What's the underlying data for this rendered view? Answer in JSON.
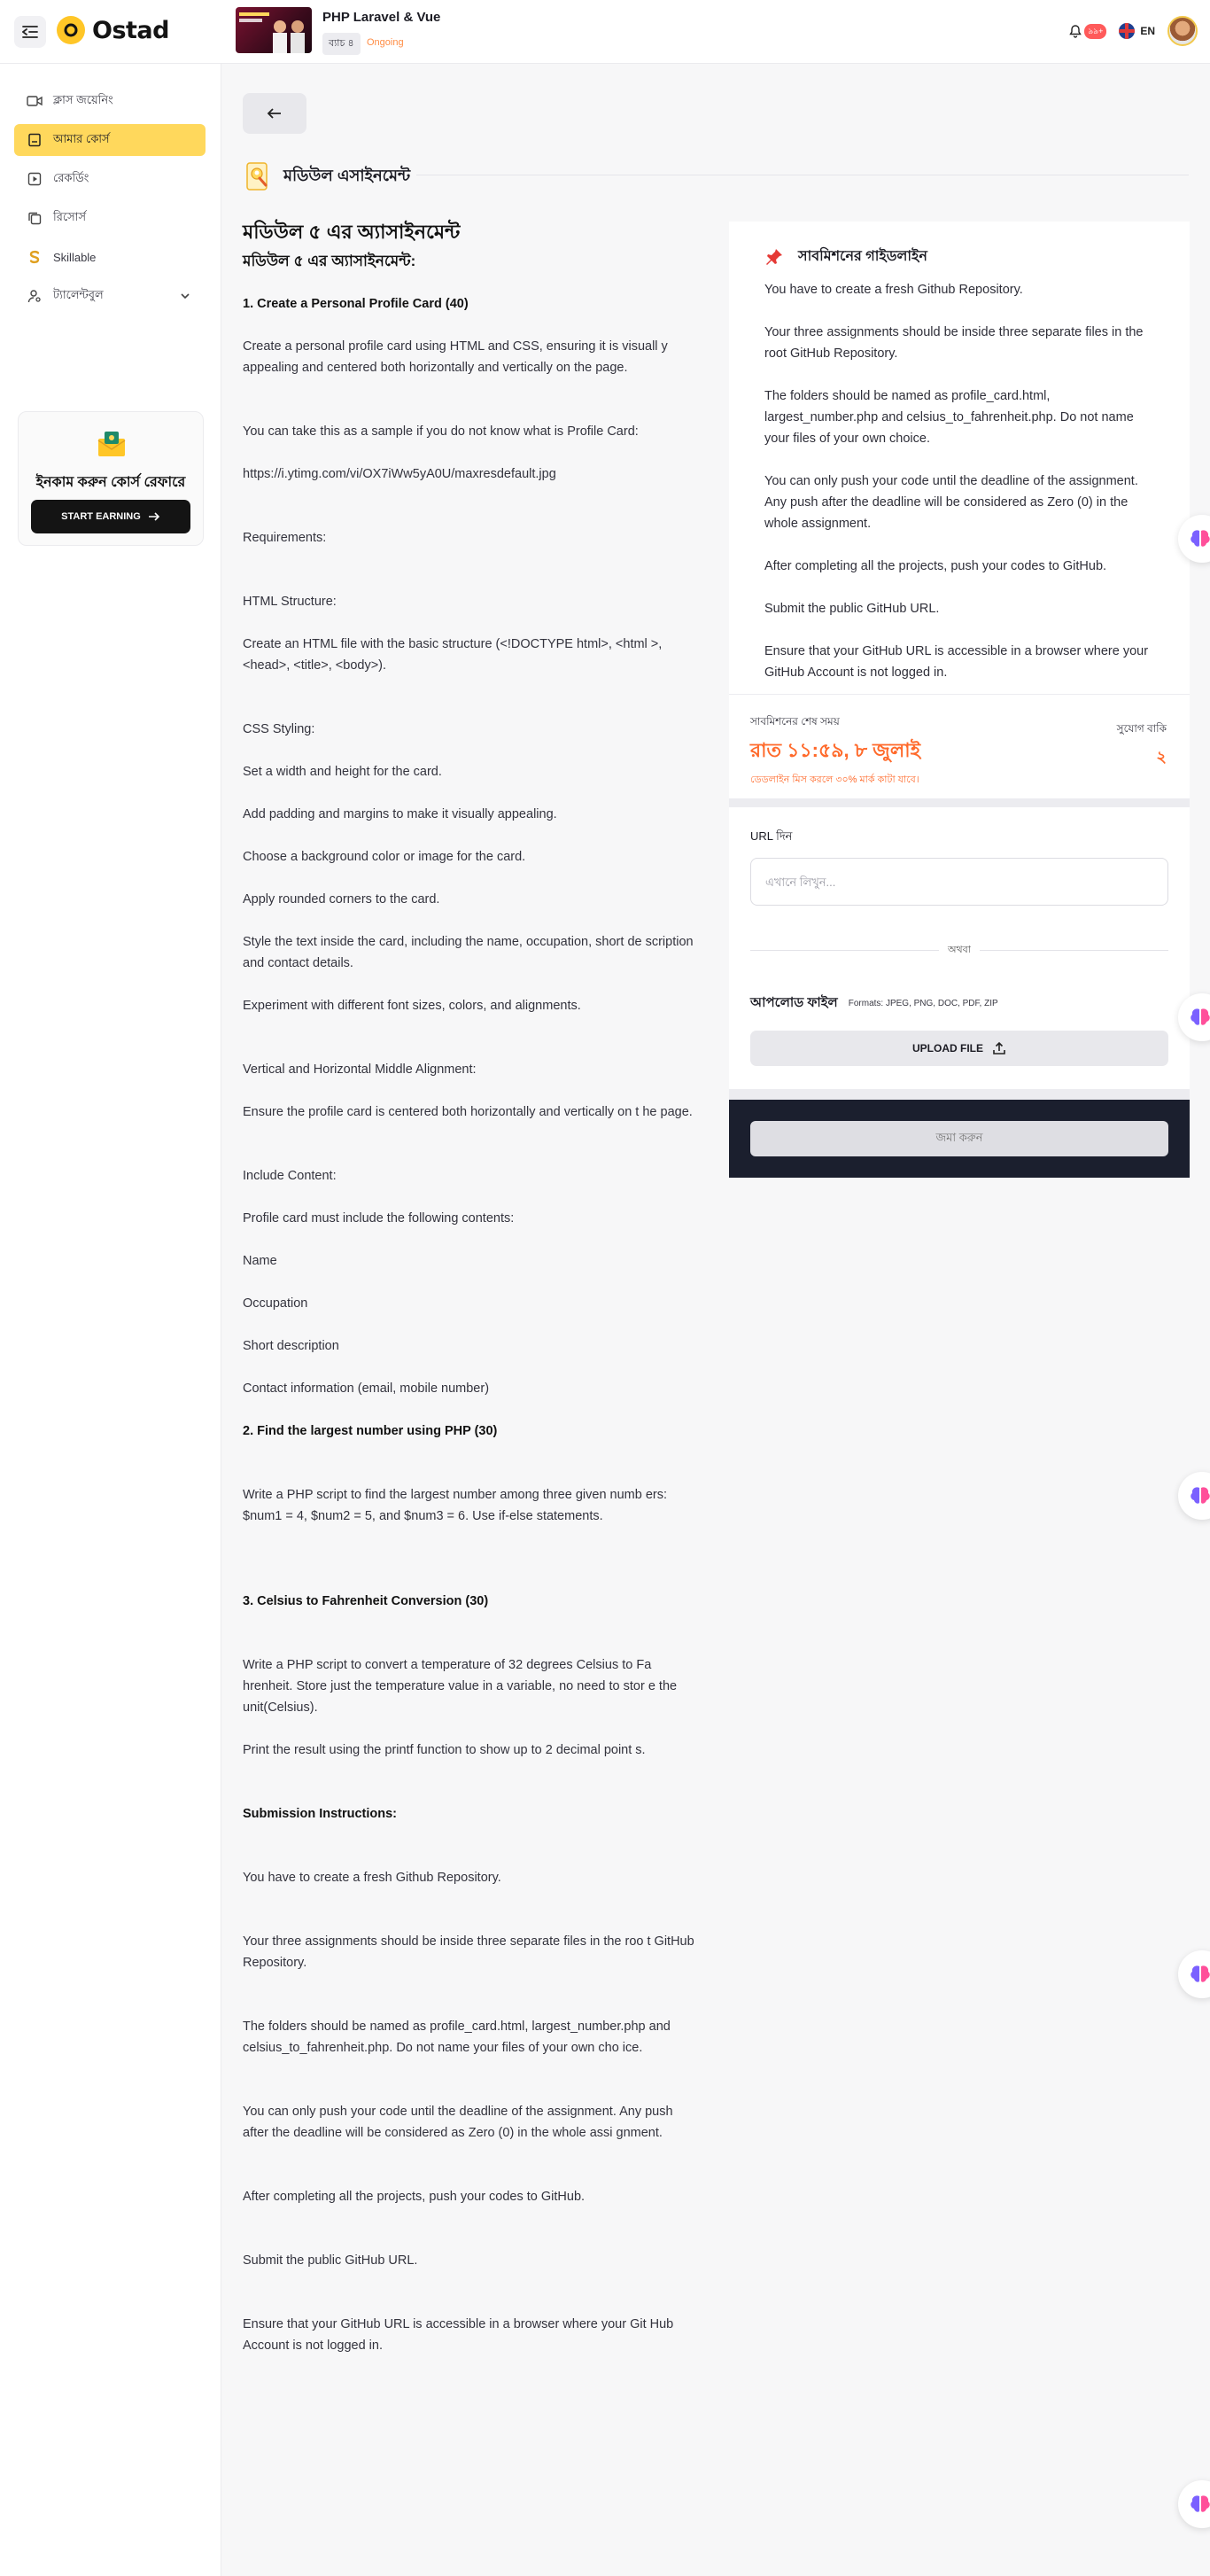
{
  "topbar": {
    "brand": "Ostad",
    "course_title": "PHP Laravel & Vue",
    "batch": "ব্যাচ ৪",
    "status": "Ongoing",
    "notification_count": "৯৯+",
    "language": "EN"
  },
  "sidebar": {
    "items": [
      {
        "label": "ক্লাস জয়েনিং",
        "icon": "video-icon"
      },
      {
        "label": "আমার কোর্স",
        "icon": "book-icon"
      },
      {
        "label": "রেকর্ডিং",
        "icon": "play-icon"
      },
      {
        "label": "রিসোর্স",
        "icon": "copy-icon"
      },
      {
        "label": "Skillable",
        "icon": "skillable-icon"
      },
      {
        "label": "ট্যালেন্টবুল",
        "icon": "user-icon"
      }
    ],
    "promo": {
      "text": "ইনকাম করুন কোর্স রেফারে",
      "button": "START EARNING"
    }
  },
  "section": {
    "title": "মডিউল এসাইনমেন্ট"
  },
  "assignment": {
    "title": "মডিউল ৫ এর অ্যাসাইনমেন্ট",
    "subtitle": "মডিউল ৫ এর অ্যাসাইনমেন্ট:",
    "q1": "1. Create a Personal Profile Card (40)",
    "p1": "Create a personal profile card using HTML and CSS, ensuring it is visuall y appealing and centered both horizontally and vertically on the page.",
    "p2": "You can take this as a sample if you do not know what is Profile Card:",
    "p3": "https://i.ytimg.com/vi/OX7iWw5yA0U/maxresdefault.jpg",
    "p4": "Requirements:",
    "p5": "HTML Structure:",
    "p6": "Create an HTML file with the basic structure (<!DOCTYPE html>, <html >, <head>, <title>, <body>).",
    "p7": "CSS Styling:",
    "p8": "Set a width and height for the card.",
    "p9": "Add padding and margins to make it visually appealing.",
    "p10": "Choose a background color or image for the card.",
    "p11": "Apply rounded corners to the card.",
    "p12": "Style the text inside the card, including the name, occupation, short de scription and contact details.",
    "p13": "Experiment with different font sizes, colors, and alignments.",
    "p14": "Vertical and Horizontal Middle Alignment:",
    "p15": "Ensure the profile card is centered both horizontally and vertically on t he page.",
    "p16": "Include Content:",
    "p17": "Profile card must include the following contents:",
    "p18": "Name",
    "p19": "Occupation",
    "p20": "Short description",
    "p21": "Contact information (email, mobile number)",
    "q2": "2. Find the largest number using PHP (30)",
    "p22": "Write a PHP script to find the largest number among three given numb ers: $num1 = 4, $num2 = 5, and $num3 = 6. Use if-else statements.",
    "q3": "3. Celsius to Fahrenheit Conversion (30)",
    "p23": "Write a PHP script to convert a temperature of 32 degrees Celsius to Fa hrenheit. Store just the temperature value in a variable, no need to stor e the unit(Celsius).",
    "p24": "Print the result using the printf function to show up to 2 decimal point s.",
    "q4": "Submission Instructions:",
    "p25": "You have to create a fresh Github Repository.",
    "p26": "Your three assignments should be inside three separate files in the roo t GitHub Repository.",
    "p27": "The folders should be named as profile_card.html, largest_number.php and celsius_to_fahrenheit.php. Do not name your files of your own cho ice.",
    "p28": "You can only push your code until the deadline of the assignment. Any push after the deadline will be considered as Zero (0) in the whole assi gnment.",
    "p29": "After completing all the projects, push your codes to GitHub.",
    "p30": "Submit the public GitHub URL.",
    "p31": "Ensure that your GitHub URL is accessible in a browser where your Git Hub Account is not logged in."
  },
  "guidelines": {
    "title": "সাবমিশনের গাইডলাইন",
    "items": [
      "You have to create a fresh Github Repository.",
      "Your three assignments should be inside three separate files in the root GitHub Repository.",
      "The folders should be named as profile_card.html, largest_number.php and celsius_to_fahrenheit.php. Do not name your files of your own choice.",
      "You can only push your code until the deadline of the assignment. Any push after the deadline will be considered as Zero (0) in the whole assignment.",
      "After completing all the projects, push your codes to GitHub.",
      "Submit the public GitHub URL.",
      "Ensure that your GitHub URL is accessible in a browser where your GitHub Account is not logged in."
    ]
  },
  "deadline": {
    "label": "সাবমিশনের শেষ সময়",
    "time": "রাত ১১:৫৯, ৮ জুলাই",
    "note": "ডেডলাইন মিস করলে ৩০% মার্ক কাটা যাবে।",
    "chance_label": "সুযোগ বাকি",
    "chance_value": "২"
  },
  "form": {
    "url_label": "URL দিন",
    "url_placeholder": "এখানে লিখুন...",
    "or": "অথবা",
    "upload_label": "আপলোড ফাইল",
    "formats": "Formats: JPEG, PNG, DOC, PDF, ZIP",
    "upload_button": "UPLOAD FILE",
    "submit_button": "জমা করুন"
  },
  "colors": {
    "accent": "#ffd85c",
    "deadline": "#ff6a2b",
    "submit_bar": "#1b1f2e"
  }
}
